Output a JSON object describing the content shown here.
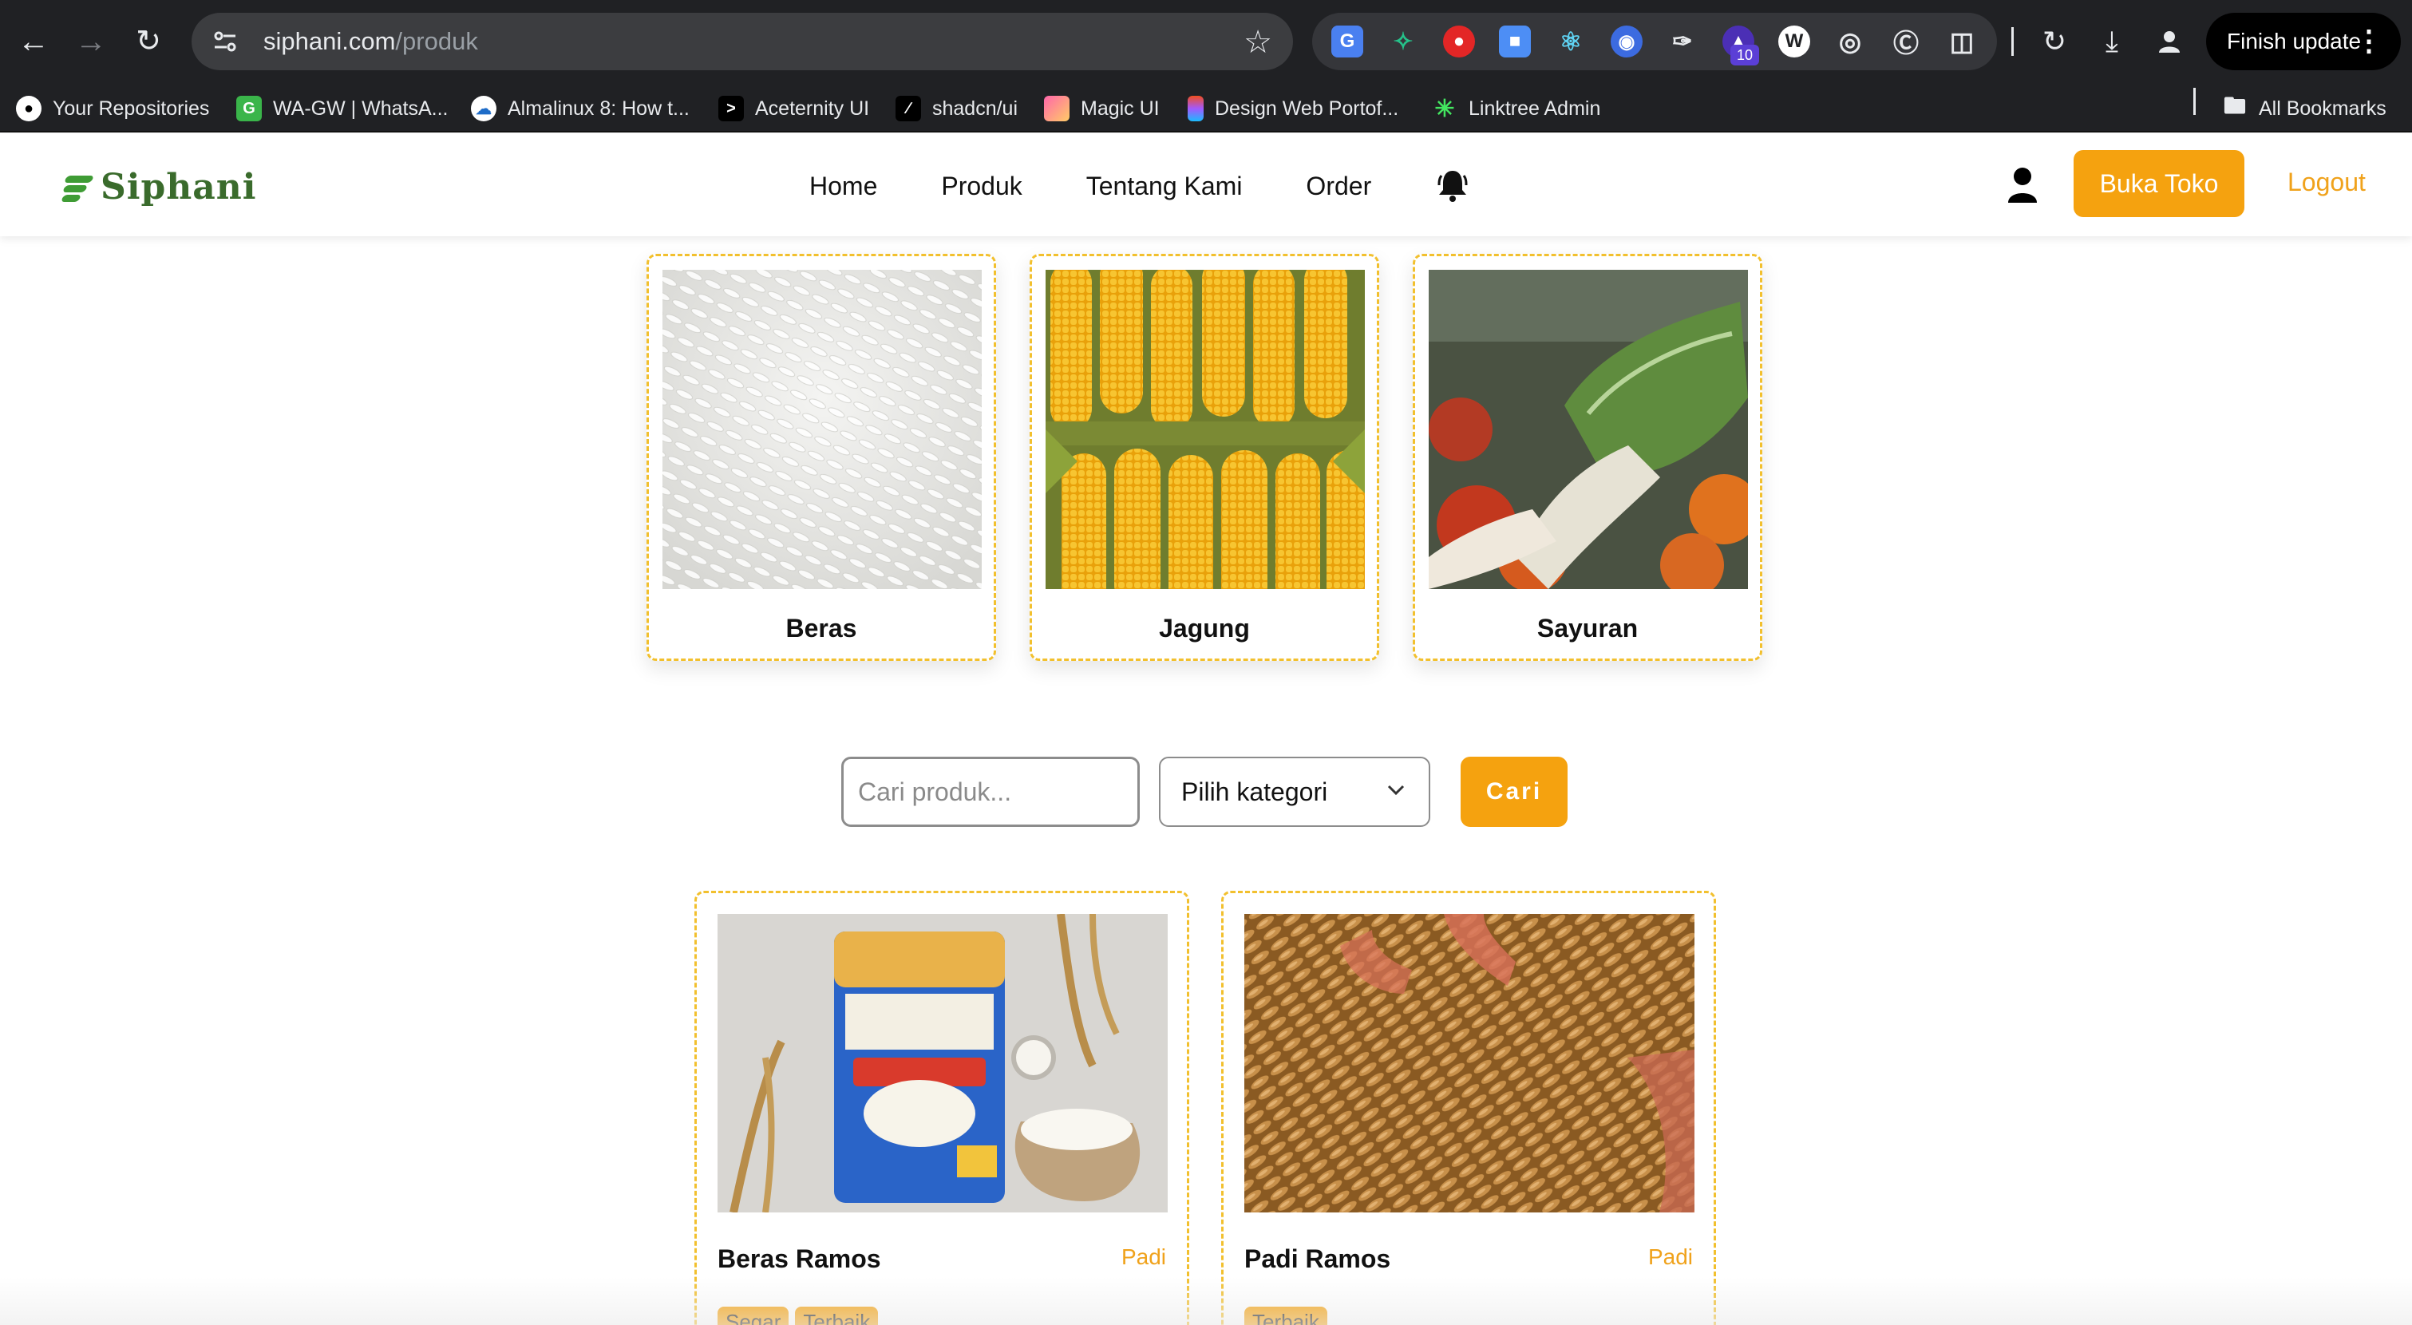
{
  "browser": {
    "url_domain": "siphani.com",
    "url_path": "/produk",
    "update_button": "Finish update",
    "extension_badge": "10",
    "bookmarks": [
      {
        "label": "Your Repositories",
        "icon": "github-icon"
      },
      {
        "label": "WA-GW | WhatsA...",
        "icon": "wa-gw-icon"
      },
      {
        "label": "Almalinux 8: How t...",
        "icon": "almalinux-icon"
      },
      {
        "label": "Aceternity UI",
        "icon": "aceternity-icon"
      },
      {
        "label": "shadcn/ui",
        "icon": "shadcn-icon"
      },
      {
        "label": "Magic UI",
        "icon": "magicui-icon"
      },
      {
        "label": "Design Web Portof...",
        "icon": "figma-icon"
      },
      {
        "label": "Linktree Admin",
        "icon": "linktree-icon"
      }
    ],
    "all_bookmarks": "All Bookmarks"
  },
  "header": {
    "logo_text": "Siphani",
    "nav": [
      "Home",
      "Produk",
      "Tentang Kami",
      "Order"
    ],
    "buka_toko": "Buka Toko",
    "logout": "Logout"
  },
  "categories": [
    {
      "title": "Beras",
      "image": "rice-grains"
    },
    {
      "title": "Jagung",
      "image": "corn-cobs"
    },
    {
      "title": "Sayuran",
      "image": "vegetables"
    }
  ],
  "search": {
    "placeholder": "Cari produk...",
    "category_select": "Pilih kategori",
    "button": "Cari"
  },
  "products": [
    {
      "name": "Beras Ramos",
      "category": "Padi",
      "tags": [
        "Segar",
        "Terbaik"
      ]
    },
    {
      "name": "Padi Ramos",
      "category": "Padi",
      "tags": [
        "Terbaik"
      ]
    }
  ],
  "colors": {
    "accent": "#f5a20f",
    "dashed_border": "#f2c02e",
    "logo_green": "#3f9c35",
    "chrome_bg": "#202124"
  }
}
